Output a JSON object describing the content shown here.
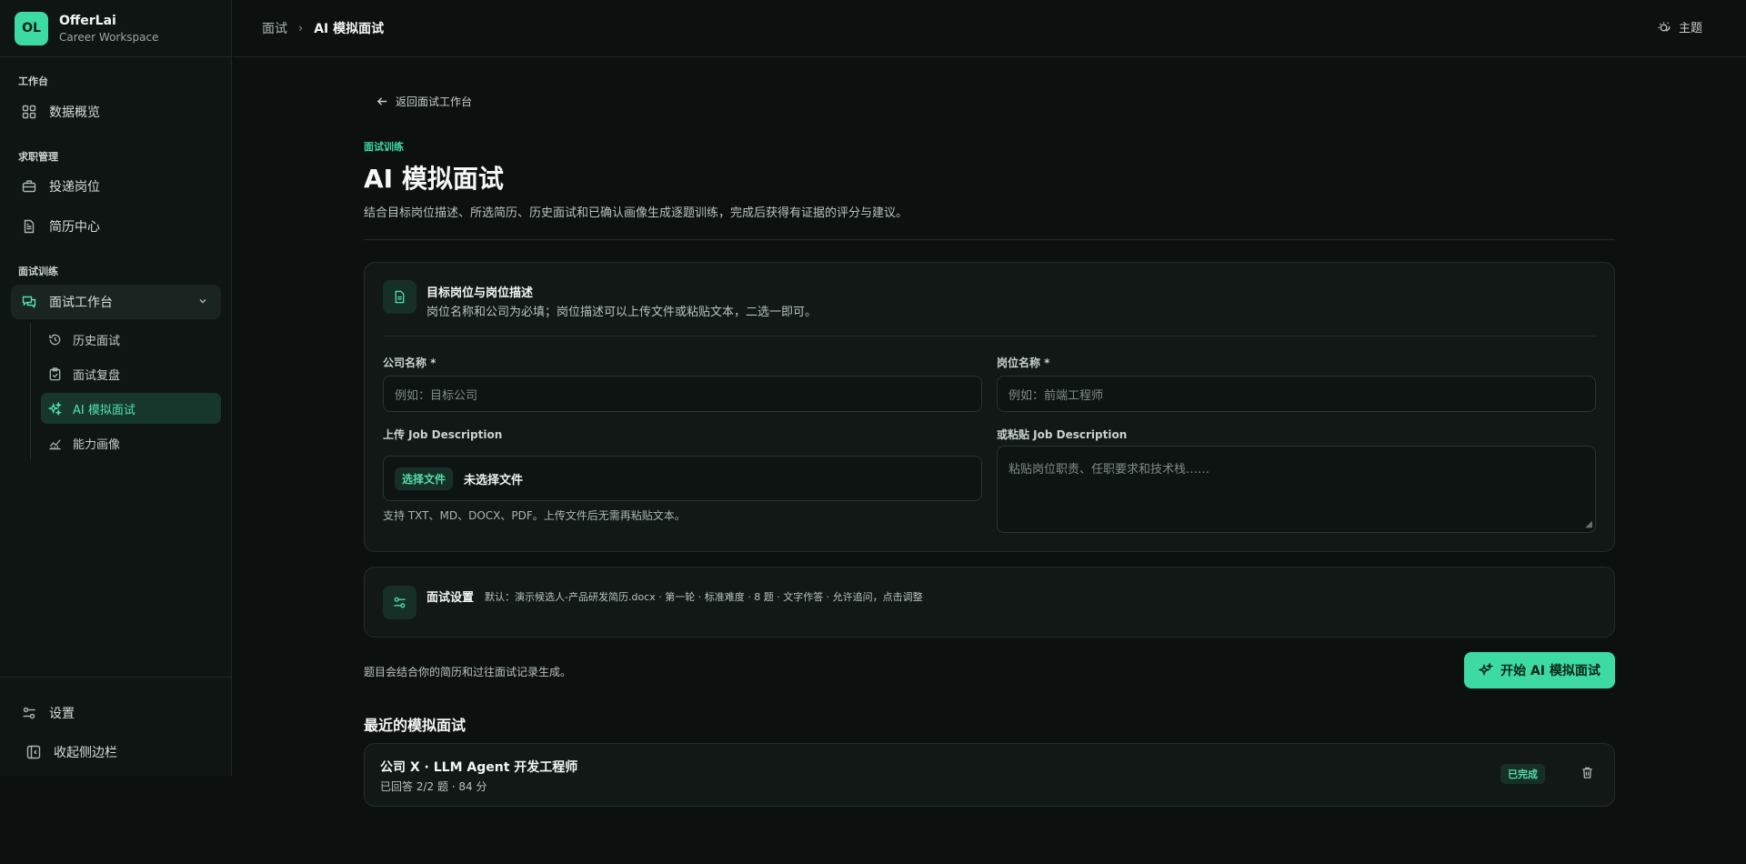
{
  "brand": {
    "logo": "OL",
    "name": "OfferLai",
    "subtitle": "Career Workspace"
  },
  "sidebar": {
    "sections": {
      "workspace": "工作台",
      "job": "求职管理",
      "interview": "面试训练"
    },
    "items": {
      "overview": "数据概览",
      "applications": "投递岗位",
      "resumes": "简历中心",
      "interview_workbench": "面试工作台",
      "history": "历史面试",
      "review": "面试复盘",
      "mock": "AI 模拟面试",
      "profile": "能力画像"
    },
    "bottom": {
      "settings": "设置",
      "collapse": "收起侧边栏"
    }
  },
  "topbar": {
    "breadcrumb_parent": "面试",
    "breadcrumb_separator": "›",
    "breadcrumb_current": "AI 模拟面试",
    "theme_label": "主题"
  },
  "page": {
    "back_link": "返回面试工作台",
    "eyebrow": "面试训练",
    "title": "AI 模拟面试",
    "description": "结合目标岗位描述、所选简历、历史面试和已确认画像生成逐题训练，完成后获得有证据的评分与建议。"
  },
  "job_card": {
    "title": "目标岗位与岗位描述",
    "subtitle": "岗位名称和公司为必填；岗位描述可以上传文件或粘贴文本，二选一即可。",
    "company_label": "公司名称 *",
    "company_placeholder": "例如：目标公司",
    "position_label": "岗位名称 *",
    "position_placeholder": "例如：前端工程师",
    "upload_label": "上传 Job Description",
    "choose_file": "选择文件",
    "no_file": "未选择文件",
    "upload_hint": "支持 TXT、MD、DOCX、PDF。上传文件后无需再粘贴文本。",
    "paste_label": "或粘贴 Job Description",
    "paste_placeholder": "粘贴岗位职责、任职要求和技术栈……"
  },
  "settings_card": {
    "title": "面试设置",
    "summary": "默认：演示候选人-产品研发简历.docx · 第一轮 · 标准难度 · 8 题 · 文字作答 · 允许追问，点击调整"
  },
  "footer": {
    "note": "题目会结合你的简历和过往面试记录生成。",
    "start_button": "开始 AI 模拟面试"
  },
  "recent": {
    "title": "最近的模拟面试",
    "items": [
      {
        "title": "公司 X · LLM Agent 开发工程师",
        "meta": "已回答 2/2 题 · 84 分",
        "status": "已完成"
      }
    ]
  },
  "colors": {
    "accent": "#3ddba3",
    "background": "#0c1110",
    "surface": "#111816"
  }
}
